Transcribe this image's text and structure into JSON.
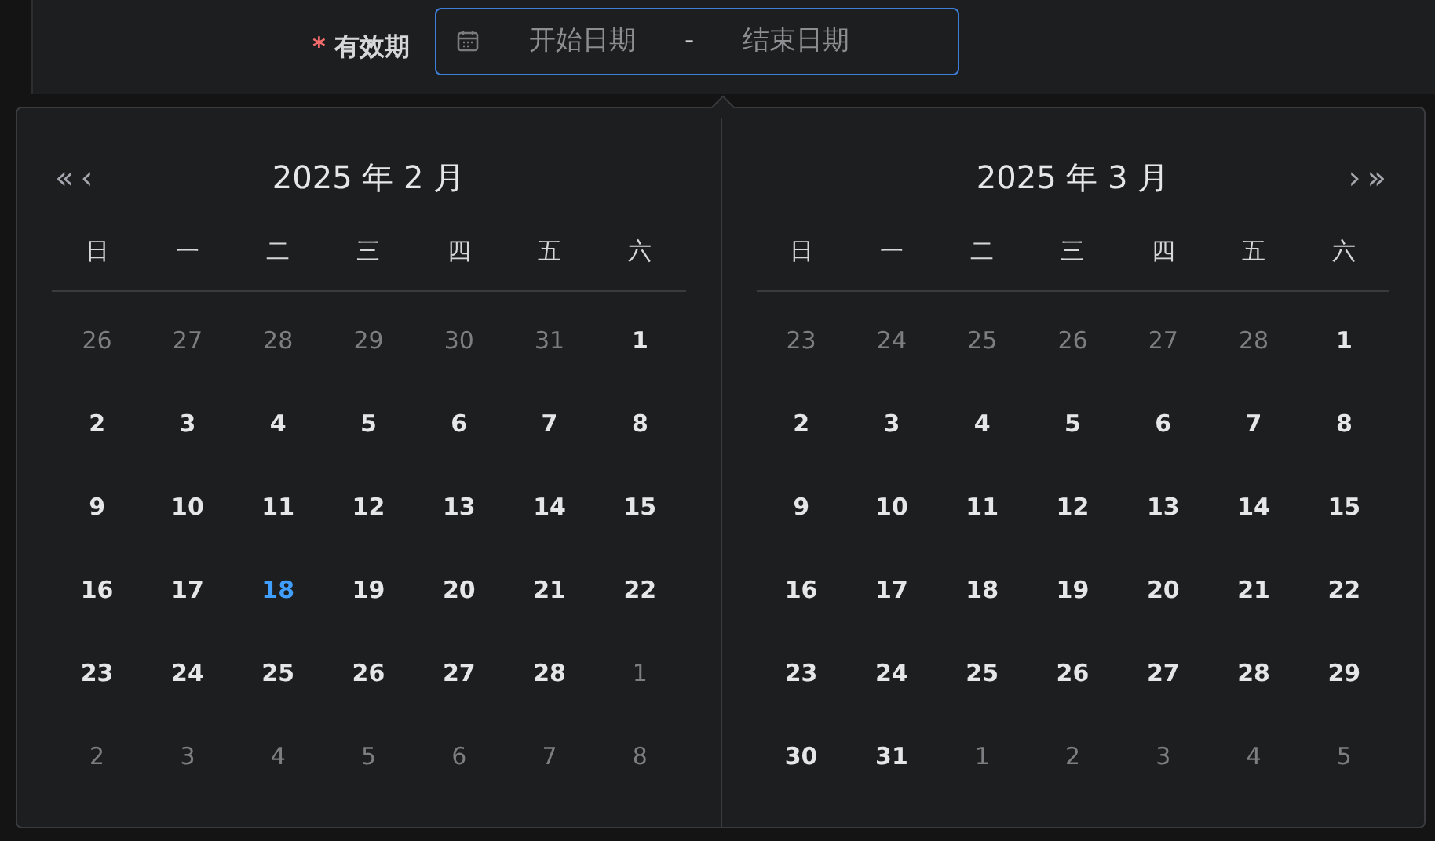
{
  "field": {
    "required_mark": "*",
    "label": "有效期",
    "start_placeholder": "开始日期",
    "separator": "-",
    "end_placeholder": "结束日期"
  },
  "panels": [
    {
      "title": "2025 年 2 月",
      "nav_left": [
        "«",
        "‹"
      ],
      "weekdays": [
        "日",
        "一",
        "二",
        "三",
        "四",
        "五",
        "六"
      ],
      "weeks": [
        [
          {
            "d": "26",
            "kind": "muted"
          },
          {
            "d": "27",
            "kind": "muted"
          },
          {
            "d": "28",
            "kind": "muted"
          },
          {
            "d": "29",
            "kind": "muted"
          },
          {
            "d": "30",
            "kind": "muted"
          },
          {
            "d": "31",
            "kind": "muted"
          },
          {
            "d": "1",
            "kind": "normal"
          }
        ],
        [
          {
            "d": "2",
            "kind": "normal"
          },
          {
            "d": "3",
            "kind": "normal"
          },
          {
            "d": "4",
            "kind": "normal"
          },
          {
            "d": "5",
            "kind": "normal"
          },
          {
            "d": "6",
            "kind": "normal"
          },
          {
            "d": "7",
            "kind": "normal"
          },
          {
            "d": "8",
            "kind": "normal"
          }
        ],
        [
          {
            "d": "9",
            "kind": "normal"
          },
          {
            "d": "10",
            "kind": "normal"
          },
          {
            "d": "11",
            "kind": "normal"
          },
          {
            "d": "12",
            "kind": "normal"
          },
          {
            "d": "13",
            "kind": "normal"
          },
          {
            "d": "14",
            "kind": "normal"
          },
          {
            "d": "15",
            "kind": "normal"
          }
        ],
        [
          {
            "d": "16",
            "kind": "normal"
          },
          {
            "d": "17",
            "kind": "normal"
          },
          {
            "d": "18",
            "kind": "today"
          },
          {
            "d": "19",
            "kind": "normal"
          },
          {
            "d": "20",
            "kind": "normal"
          },
          {
            "d": "21",
            "kind": "normal"
          },
          {
            "d": "22",
            "kind": "normal"
          }
        ],
        [
          {
            "d": "23",
            "kind": "normal"
          },
          {
            "d": "24",
            "kind": "normal"
          },
          {
            "d": "25",
            "kind": "normal"
          },
          {
            "d": "26",
            "kind": "normal"
          },
          {
            "d": "27",
            "kind": "normal"
          },
          {
            "d": "28",
            "kind": "normal"
          },
          {
            "d": "1",
            "kind": "muted"
          }
        ],
        [
          {
            "d": "2",
            "kind": "muted"
          },
          {
            "d": "3",
            "kind": "muted"
          },
          {
            "d": "4",
            "kind": "muted"
          },
          {
            "d": "5",
            "kind": "muted"
          },
          {
            "d": "6",
            "kind": "muted"
          },
          {
            "d": "7",
            "kind": "muted"
          },
          {
            "d": "8",
            "kind": "muted"
          }
        ]
      ]
    },
    {
      "title": "2025 年 3 月",
      "nav_right": [
        "›",
        "»"
      ],
      "weekdays": [
        "日",
        "一",
        "二",
        "三",
        "四",
        "五",
        "六"
      ],
      "weeks": [
        [
          {
            "d": "23",
            "kind": "muted"
          },
          {
            "d": "24",
            "kind": "muted"
          },
          {
            "d": "25",
            "kind": "muted"
          },
          {
            "d": "26",
            "kind": "muted"
          },
          {
            "d": "27",
            "kind": "muted"
          },
          {
            "d": "28",
            "kind": "muted"
          },
          {
            "d": "1",
            "kind": "normal"
          }
        ],
        [
          {
            "d": "2",
            "kind": "normal"
          },
          {
            "d": "3",
            "kind": "normal"
          },
          {
            "d": "4",
            "kind": "normal"
          },
          {
            "d": "5",
            "kind": "normal"
          },
          {
            "d": "6",
            "kind": "normal"
          },
          {
            "d": "7",
            "kind": "normal"
          },
          {
            "d": "8",
            "kind": "normal"
          }
        ],
        [
          {
            "d": "9",
            "kind": "normal"
          },
          {
            "d": "10",
            "kind": "normal"
          },
          {
            "d": "11",
            "kind": "normal"
          },
          {
            "d": "12",
            "kind": "normal"
          },
          {
            "d": "13",
            "kind": "normal"
          },
          {
            "d": "14",
            "kind": "normal"
          },
          {
            "d": "15",
            "kind": "normal"
          }
        ],
        [
          {
            "d": "16",
            "kind": "normal"
          },
          {
            "d": "17",
            "kind": "normal"
          },
          {
            "d": "18",
            "kind": "normal"
          },
          {
            "d": "19",
            "kind": "normal"
          },
          {
            "d": "20",
            "kind": "normal"
          },
          {
            "d": "21",
            "kind": "normal"
          },
          {
            "d": "22",
            "kind": "normal"
          }
        ],
        [
          {
            "d": "23",
            "kind": "normal"
          },
          {
            "d": "24",
            "kind": "normal"
          },
          {
            "d": "25",
            "kind": "normal"
          },
          {
            "d": "26",
            "kind": "normal"
          },
          {
            "d": "27",
            "kind": "normal"
          },
          {
            "d": "28",
            "kind": "normal"
          },
          {
            "d": "29",
            "kind": "normal"
          }
        ],
        [
          {
            "d": "30",
            "kind": "normal"
          },
          {
            "d": "31",
            "kind": "normal"
          },
          {
            "d": "1",
            "kind": "muted"
          },
          {
            "d": "2",
            "kind": "muted"
          },
          {
            "d": "3",
            "kind": "muted"
          },
          {
            "d": "4",
            "kind": "muted"
          },
          {
            "d": "5",
            "kind": "muted"
          }
        ]
      ]
    }
  ]
}
